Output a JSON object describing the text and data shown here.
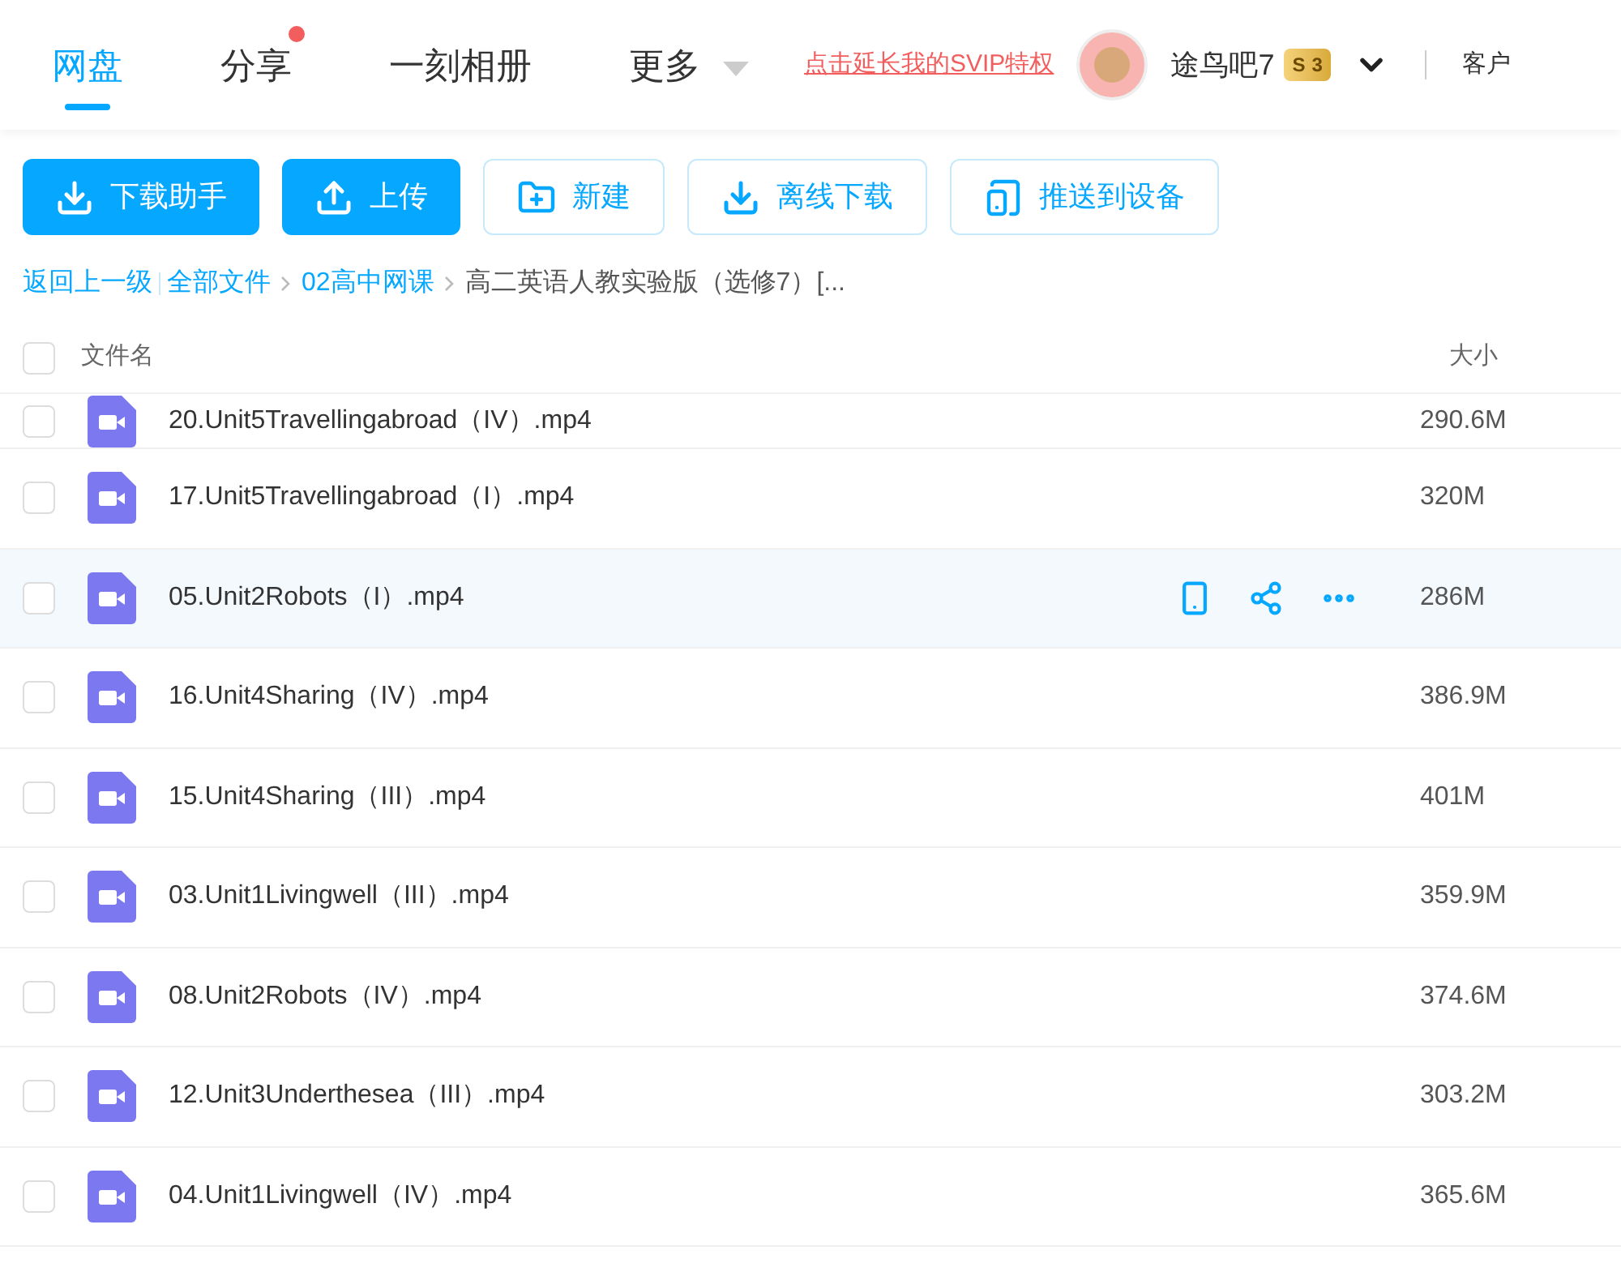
{
  "nav": {
    "tabs": [
      {
        "label": "网盘",
        "selected": true,
        "dot": false,
        "caret": false
      },
      {
        "label": "分享",
        "selected": false,
        "dot": true,
        "caret": false
      },
      {
        "label": "一刻相册",
        "selected": false,
        "dot": false,
        "caret": false
      },
      {
        "label": "更多",
        "selected": false,
        "dot": false,
        "caret": true
      }
    ],
    "promo_link": "点击延长我的SVIP特权",
    "username": "途鸟吧7",
    "vip_badge": {
      "letter": "S",
      "level": "3"
    },
    "client_link": "客户"
  },
  "toolbar": [
    {
      "label": "下载助手",
      "kind": "primary"
    },
    {
      "label": "上传",
      "kind": "primary"
    },
    {
      "label": "新建",
      "kind": "outline"
    },
    {
      "label": "离线下载",
      "kind": "outline"
    },
    {
      "label": "推送到设备",
      "kind": "outline"
    }
  ],
  "breadcrumb": {
    "back": "返回上一级",
    "items": [
      "全部文件",
      "02高中网课"
    ],
    "current": "高二英语人教实验版（选修7）[..."
  },
  "table": {
    "all_checked": false,
    "columns": [
      "文件名",
      "大小"
    ],
    "rows": [
      {
        "name": "20.Unit5Travellingabroad（IV）.mp4",
        "size": "290.6M",
        "checked": false,
        "hovered": false
      },
      {
        "name": "17.Unit5Travellingabroad（I）.mp4",
        "size": "320M",
        "checked": false,
        "hovered": false
      },
      {
        "name": "05.Unit2Robots（I）.mp4",
        "size": "286M",
        "checked": false,
        "hovered": true
      },
      {
        "name": "16.Unit4Sharing（IV）.mp4",
        "size": "386.9M",
        "checked": false,
        "hovered": false
      },
      {
        "name": "15.Unit4Sharing（III）.mp4",
        "size": "401M",
        "checked": false,
        "hovered": false
      },
      {
        "name": "03.Unit1Livingwell（III）.mp4",
        "size": "359.9M",
        "checked": false,
        "hovered": false
      },
      {
        "name": "08.Unit2Robots（IV）.mp4",
        "size": "374.6M",
        "checked": false,
        "hovered": false
      },
      {
        "name": "12.Unit3Underthesea（III）.mp4",
        "size": "303.2M",
        "checked": false,
        "hovered": false
      },
      {
        "name": "04.Unit1Livingwell（IV）.mp4",
        "size": "365.6M",
        "checked": false,
        "hovered": false
      }
    ]
  }
}
